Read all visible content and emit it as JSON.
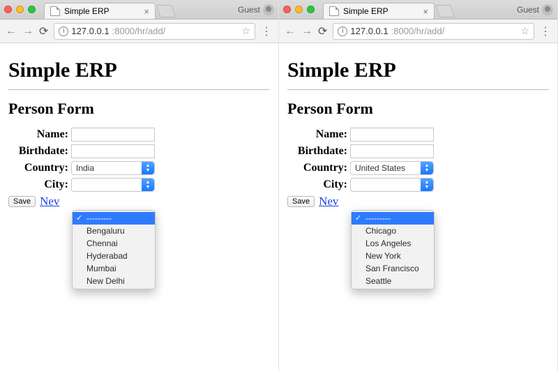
{
  "left": {
    "tab_title": "Simple ERP",
    "guest_label": "Guest",
    "url_host": "127.0.0.1",
    "url_path": ":8000/hr/add/",
    "h1": "Simple ERP",
    "h2": "Person Form",
    "labels": {
      "name": "Name:",
      "birthdate": "Birthdate:",
      "country": "Country:",
      "city": "City:"
    },
    "country_value": "India",
    "save_label": "Save",
    "new_link": "Nev",
    "city_dropdown": {
      "placeholder": "---------",
      "options": [
        "Bengaluru",
        "Chennai",
        "Hyderabad",
        "Mumbai",
        "New Delhi"
      ]
    }
  },
  "right": {
    "tab_title": "Simple ERP",
    "guest_label": "Guest",
    "url_host": "127.0.0.1",
    "url_path": ":8000/hr/add/",
    "h1": "Simple ERP",
    "h2": "Person Form",
    "labels": {
      "name": "Name:",
      "birthdate": "Birthdate:",
      "country": "Country:",
      "city": "City:"
    },
    "country_value": "United States",
    "save_label": "Save",
    "new_link": "Nev",
    "city_dropdown": {
      "placeholder": "---------",
      "options": [
        "Chicago",
        "Los Angeles",
        "New York",
        "San Francisco",
        "Seattle"
      ]
    }
  }
}
